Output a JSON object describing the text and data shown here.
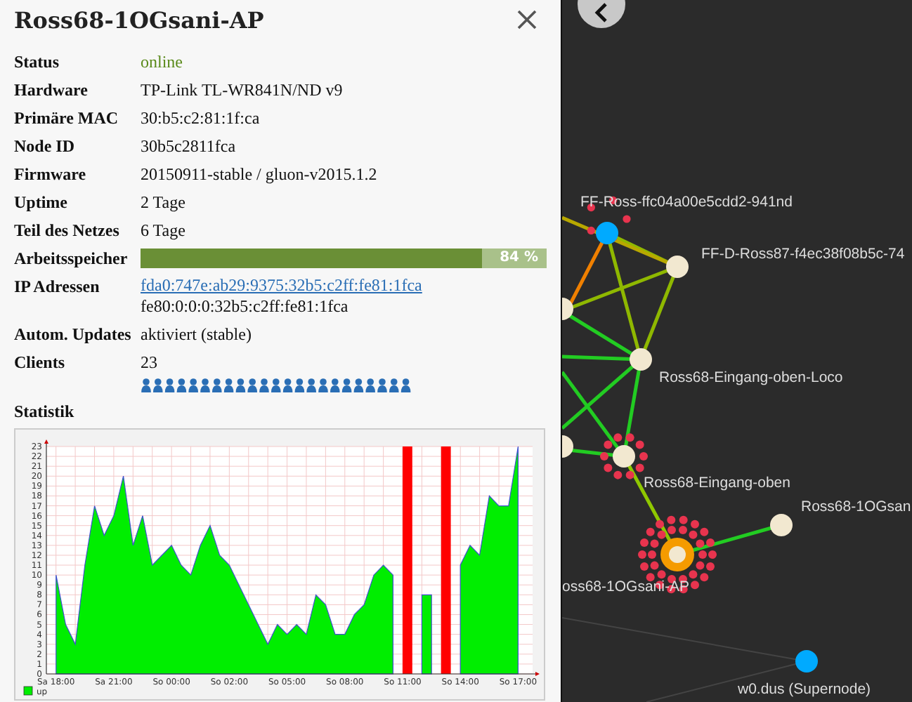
{
  "panel": {
    "title": "Ross68-1OGsani-AP",
    "rows": [
      {
        "kind": "status",
        "label": "Status",
        "value": "online",
        "online": true
      },
      {
        "kind": "text",
        "label": "Hardware",
        "value": "TP-Link TL-WR841N/ND v9"
      },
      {
        "kind": "text",
        "label": "Primäre MAC",
        "value": "30:b5:c2:81:1f:ca"
      },
      {
        "kind": "text",
        "label": "Node ID",
        "value": "30b5c2811fca"
      },
      {
        "kind": "text",
        "label": "Firmware",
        "value": "20150911-stable / gluon-v2015.1.2"
      },
      {
        "kind": "text",
        "label": "Uptime",
        "value": "2 Tage"
      },
      {
        "kind": "text",
        "label": "Teil des Netzes",
        "value": "6 Tage"
      },
      {
        "kind": "bar",
        "label": "Arbeitsspeicher",
        "value": "84 %",
        "level": 0.84
      },
      {
        "kind": "addresses",
        "label": "IP Adressen",
        "addresses": [
          {
            "text": "fda0:747e:ab29:9375:32b5:c2ff:fe81:1fca",
            "link": true
          },
          {
            "text": "fe80:0:0:0:32b5:c2ff:fe81:1fca",
            "link": false
          }
        ]
      },
      {
        "kind": "text",
        "label": "Autom. Updates",
        "value": "aktiviert (stable)"
      },
      {
        "kind": "clients",
        "label": "Clients",
        "value": "23"
      }
    ],
    "statistics": {
      "heading": "Statistik",
      "chart_data": {
        "type": "area",
        "categories": [
          "Sa 18:00",
          null,
          null,
          null,
          null,
          null,
          "Sa 21:00",
          null,
          null,
          null,
          null,
          null,
          "So 00:00",
          null,
          null,
          null,
          null,
          null,
          "So 02:00",
          null,
          null,
          null,
          null,
          null,
          "So 05:00",
          null,
          null,
          null,
          null,
          null,
          "So 08:00",
          null,
          null,
          null,
          null,
          null,
          "So 11:00",
          null,
          null,
          null,
          null,
          null,
          "So 14:00",
          null,
          null,
          null,
          null,
          null,
          "So 17:00"
        ],
        "series": [
          {
            "name": "up",
            "color": "#00ee00",
            "values": [
              10,
              5,
              3,
              11,
              17,
              14,
              16,
              20,
              13,
              16,
              11,
              12,
              13,
              11,
              10,
              13,
              15,
              12,
              11,
              9,
              7,
              5,
              3,
              5,
              4,
              5,
              4,
              8,
              7,
              4,
              4,
              6,
              7,
              10,
              11,
              10,
              null,
              null,
              8,
              8,
              null,
              null,
              11,
              13,
              12,
              18,
              17,
              17,
              23
            ]
          },
          {
            "color": "#ff0000",
            "values": [
              null,
              null,
              null,
              null,
              null,
              null,
              null,
              null,
              null,
              null,
              null,
              null,
              null,
              null,
              null,
              null,
              null,
              null,
              null,
              null,
              null,
              null,
              null,
              null,
              null,
              null,
              null,
              null,
              null,
              null,
              null,
              null,
              null,
              null,
              null,
              null,
              23,
              23,
              null,
              null,
              23,
              23,
              null,
              null,
              null,
              null,
              null,
              null,
              null
            ]
          }
        ],
        "ylim": [
          0,
          23
        ],
        "grid": true,
        "yticks": [
          0,
          1,
          2,
          3,
          4,
          5,
          6,
          7,
          8,
          9,
          10,
          11,
          12,
          13,
          14,
          15,
          16,
          17,
          18,
          19,
          20,
          21,
          22,
          23
        ]
      }
    }
  },
  "map": {
    "nodes": [
      {
        "label": "FF-Ross-ffc04a00e5cdd2-941nd",
        "kind": "gateway"
      },
      {
        "label": "FF-D-Ross87-f4ec38f08b5c-74",
        "kind": "node"
      },
      {
        "label": "Ross68-Eingang-oben-Loco",
        "kind": "node"
      },
      {
        "label": "Ross68-Eingang-oben",
        "kind": "node"
      },
      {
        "label": "Ross68-1OGsan",
        "kind": "node"
      },
      {
        "label": "oss68-1OGsani-AP",
        "kind": "selected"
      },
      {
        "label": "w0.dus (Supernode)",
        "kind": "gateway"
      }
    ]
  }
}
